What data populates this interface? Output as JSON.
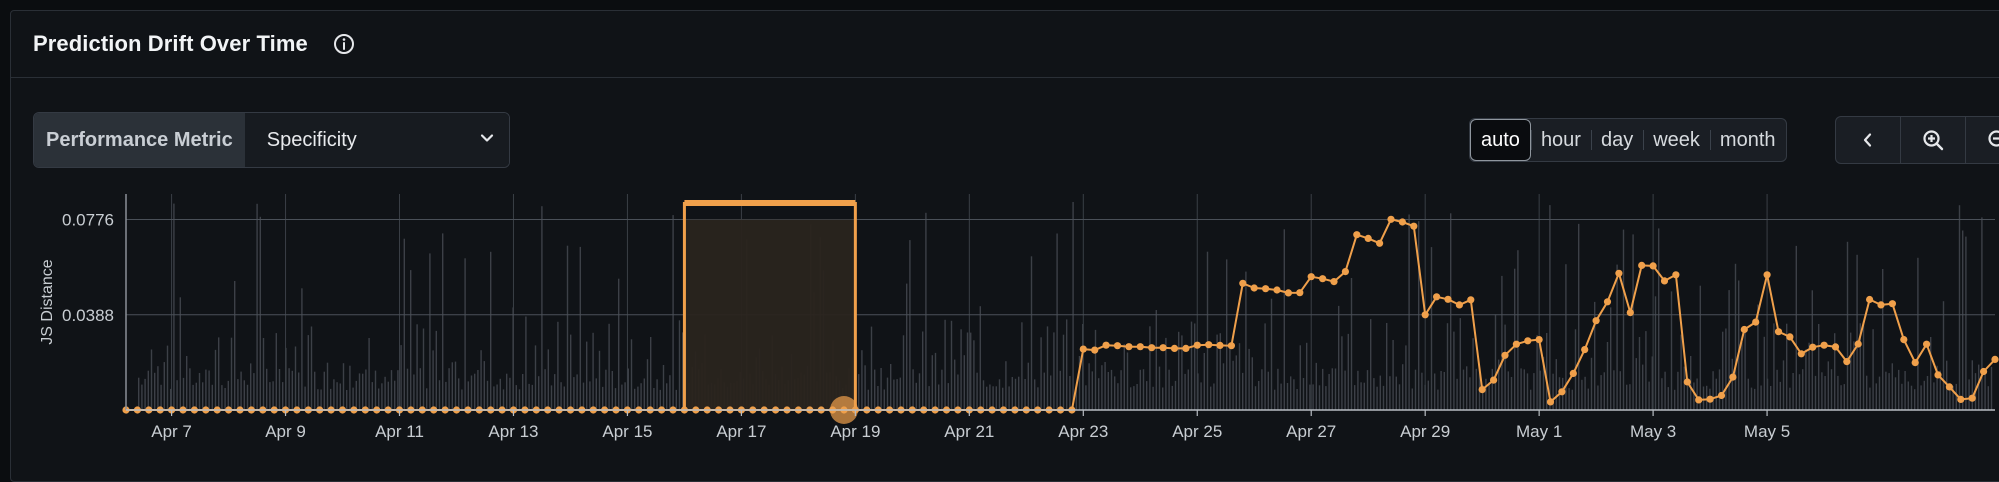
{
  "panel": {
    "title": "Prediction Drift Over Time",
    "info_icon": "info-circle-icon"
  },
  "metric_selector": {
    "label": "Performance Metric",
    "selected": "Specificity",
    "icon": "chevron-down-icon"
  },
  "granularity": {
    "options": [
      "auto",
      "hour",
      "day",
      "week",
      "month"
    ],
    "active": "auto"
  },
  "navigation": {
    "icons": [
      "chevron-left-icon",
      "zoom-in-icon",
      "zoom-out-icon"
    ]
  },
  "colors": {
    "accent": "#f0a04b",
    "selection_fill": "#2a241e",
    "grid": "#3a3f46",
    "volume_bars": "#3c4047"
  },
  "chart_data": {
    "type": "line",
    "ylabel": "JS Distance",
    "y_ticks": [
      0.0388,
      0.0776
    ],
    "ylim": [
      0,
      0.088
    ],
    "x_ticks": [
      "Apr 7",
      "Apr 9",
      "Apr 11",
      "Apr 13",
      "Apr 15",
      "Apr 17",
      "Apr 19",
      "Apr 21",
      "Apr 23",
      "Apr 25",
      "Apr 27",
      "Apr 29",
      "May 1",
      "May 3",
      "May 5"
    ],
    "x_range_days": [
      6.2,
      36.2
    ],
    "selection": {
      "start": "Apr 16",
      "end": "Apr 19",
      "highlight_x": 18.8
    },
    "series": [
      {
        "values": [
          [
            6.2,
            0
          ],
          [
            6.4,
            0
          ],
          [
            6.6,
            0
          ],
          [
            6.8,
            0
          ],
          [
            7.0,
            0
          ],
          [
            7.2,
            0
          ],
          [
            7.4,
            0
          ],
          [
            7.6,
            0
          ],
          [
            7.8,
            0
          ],
          [
            8.0,
            0
          ],
          [
            8.2,
            0
          ],
          [
            8.4,
            0
          ],
          [
            8.6,
            0
          ],
          [
            8.8,
            0
          ],
          [
            9.0,
            0
          ],
          [
            9.2,
            0
          ],
          [
            9.4,
            0
          ],
          [
            9.6,
            0
          ],
          [
            9.8,
            0
          ],
          [
            10.0,
            0
          ],
          [
            10.2,
            0
          ],
          [
            10.4,
            0
          ],
          [
            10.6,
            0
          ],
          [
            10.8,
            0
          ],
          [
            11.0,
            0
          ],
          [
            11.2,
            0
          ],
          [
            11.4,
            0
          ],
          [
            11.6,
            0
          ],
          [
            11.8,
            0
          ],
          [
            12.0,
            0
          ],
          [
            12.2,
            0
          ],
          [
            12.4,
            0
          ],
          [
            12.6,
            0
          ],
          [
            12.8,
            0
          ],
          [
            13.0,
            0
          ],
          [
            13.2,
            0
          ],
          [
            13.4,
            0
          ],
          [
            13.6,
            0
          ],
          [
            13.8,
            0
          ],
          [
            14.0,
            0
          ],
          [
            14.2,
            0
          ],
          [
            14.4,
            0
          ],
          [
            14.6,
            0
          ],
          [
            14.8,
            0
          ],
          [
            15.0,
            0
          ],
          [
            15.2,
            0
          ],
          [
            15.4,
            0
          ],
          [
            15.6,
            0
          ],
          [
            15.8,
            0
          ],
          [
            16.0,
            0
          ],
          [
            16.2,
            0
          ],
          [
            16.4,
            0
          ],
          [
            16.6,
            0
          ],
          [
            16.8,
            0
          ],
          [
            17.0,
            0
          ],
          [
            17.2,
            0
          ],
          [
            17.4,
            0
          ],
          [
            17.6,
            0
          ],
          [
            17.8,
            0
          ],
          [
            18.0,
            0
          ],
          [
            18.2,
            0
          ],
          [
            18.4,
            0
          ],
          [
            18.6,
            0
          ],
          [
            18.8,
            0
          ],
          [
            19.0,
            0
          ],
          [
            19.2,
            0
          ],
          [
            19.4,
            0
          ],
          [
            19.6,
            0
          ],
          [
            19.8,
            0
          ],
          [
            20.0,
            0
          ],
          [
            20.2,
            0
          ],
          [
            20.4,
            0
          ],
          [
            20.6,
            0
          ],
          [
            20.8,
            0
          ],
          [
            21.0,
            0
          ],
          [
            21.2,
            0
          ],
          [
            21.4,
            0
          ],
          [
            21.6,
            0
          ],
          [
            21.8,
            0
          ],
          [
            22.0,
            0
          ],
          [
            22.2,
            0
          ],
          [
            22.4,
            0
          ],
          [
            22.6,
            0
          ],
          [
            22.8,
            0
          ],
          [
            23.0,
            0.0248
          ],
          [
            23.2,
            0.0244
          ],
          [
            23.4,
            0.0264
          ],
          [
            23.6,
            0.0262
          ],
          [
            23.8,
            0.0258
          ],
          [
            24.0,
            0.0258
          ],
          [
            24.2,
            0.0254
          ],
          [
            24.4,
            0.0254
          ],
          [
            24.6,
            0.0251
          ],
          [
            24.8,
            0.0251
          ],
          [
            25.0,
            0.0264
          ],
          [
            25.2,
            0.0266
          ],
          [
            25.4,
            0.0263
          ],
          [
            25.6,
            0.0262
          ],
          [
            25.8,
            0.0516
          ],
          [
            26.0,
            0.0497
          ],
          [
            26.2,
            0.0494
          ],
          [
            26.4,
            0.0489
          ],
          [
            26.6,
            0.0477
          ],
          [
            26.8,
            0.0478
          ],
          [
            27.0,
            0.0543
          ],
          [
            27.2,
            0.0535
          ],
          [
            27.4,
            0.0523
          ],
          [
            27.6,
            0.0564
          ],
          [
            27.8,
            0.0714
          ],
          [
            28.0,
            0.0699
          ],
          [
            28.2,
            0.0679
          ],
          [
            28.4,
            0.0777
          ],
          [
            28.6,
            0.0766
          ],
          [
            28.8,
            0.0749
          ],
          [
            29.0,
            0.0388
          ],
          [
            29.2,
            0.0461
          ],
          [
            29.4,
            0.0451
          ],
          [
            29.6,
            0.0428
          ],
          [
            29.8,
            0.0449
          ],
          [
            30.0,
            0.0083
          ],
          [
            30.2,
            0.0122
          ],
          [
            30.4,
            0.0223
          ],
          [
            30.6,
            0.0268
          ],
          [
            30.8,
            0.0282
          ],
          [
            31.0,
            0.0287
          ],
          [
            31.2,
            0.0033
          ],
          [
            31.4,
            0.0074
          ],
          [
            31.6,
            0.0149
          ],
          [
            31.8,
            0.0246
          ],
          [
            32.0,
            0.0364
          ],
          [
            32.2,
            0.0441
          ],
          [
            32.4,
            0.0557
          ],
          [
            32.6,
            0.0397
          ],
          [
            32.8,
            0.0589
          ],
          [
            33.0,
            0.0587
          ],
          [
            33.2,
            0.0526
          ],
          [
            33.4,
            0.0551
          ],
          [
            33.6,
            0.0114
          ],
          [
            33.8,
            0.0041
          ],
          [
            34.0,
            0.0044
          ],
          [
            34.2,
            0.0059
          ],
          [
            34.4,
            0.0134
          ],
          [
            34.6,
            0.0328
          ],
          [
            34.8,
            0.0358
          ],
          [
            35.0,
            0.0551
          ],
          [
            35.2,
            0.0319
          ],
          [
            35.4,
            0.0298
          ],
          [
            35.6,
            0.0229
          ],
          [
            35.8,
            0.0256
          ],
          [
            36.0,
            0.0264
          ],
          [
            36.2,
            0.0257
          ],
          [
            36.4,
            0.0197
          ],
          [
            36.6,
            0.0269
          ],
          [
            36.8,
            0.045
          ],
          [
            37.0,
            0.0428
          ],
          [
            37.2,
            0.0433
          ],
          [
            37.4,
            0.0287
          ],
          [
            37.6,
            0.0193
          ],
          [
            37.8,
            0.0268
          ],
          [
            38.0,
            0.0143
          ],
          [
            38.2,
            0.0094
          ],
          [
            38.4,
            0.0043
          ],
          [
            38.6,
            0.0048
          ],
          [
            38.8,
            0.0157
          ],
          [
            39.0,
            0.0206
          ]
        ]
      }
    ]
  }
}
